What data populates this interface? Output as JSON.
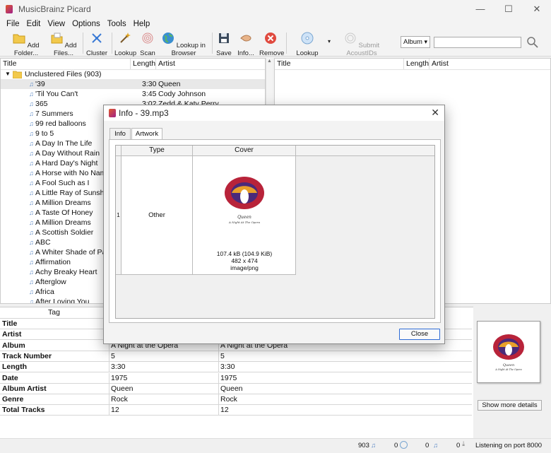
{
  "window": {
    "title": "MusicBrainz Picard",
    "controls": [
      "—",
      "☐",
      "✕"
    ]
  },
  "menu": [
    "File",
    "Edit",
    "View",
    "Options",
    "Tools",
    "Help"
  ],
  "toolbar": {
    "buttons": [
      {
        "label": "Add Folder...",
        "icon": "folder-icon"
      },
      {
        "label": "Add Files...",
        "icon": "files-icon"
      },
      {
        "label": "Cluster",
        "icon": "cluster-icon"
      },
      {
        "label": "Lookup",
        "icon": "magic-wand-icon"
      },
      {
        "label": "Scan",
        "icon": "fingerprint-icon"
      },
      {
        "label": "Lookup in Browser",
        "icon": "globe-icon"
      },
      {
        "label": "Save",
        "icon": "save-icon"
      },
      {
        "label": "Info...",
        "icon": "info-hand-icon"
      },
      {
        "label": "Remove",
        "icon": "remove-icon"
      },
      {
        "label": "Lookup CD...",
        "icon": "cd-icon"
      },
      {
        "label": "Submit AcoustIDs",
        "icon": "acoustid-icon"
      }
    ],
    "search_type": "Album",
    "search_value": ""
  },
  "left_pane": {
    "columns": [
      "Title",
      "Length",
      "Artist"
    ],
    "cluster_label": "Unclustered Files (903)",
    "files": [
      {
        "title": "'39",
        "length": "3:30",
        "artist": "Queen"
      },
      {
        "title": "'Til You Can't",
        "length": "3:45",
        "artist": "Cody Johnson"
      },
      {
        "title": "365",
        "length": "3:02",
        "artist": "Zedd & Katy Perry"
      },
      {
        "title": "7 Summers",
        "length": "",
        "artist": ""
      },
      {
        "title": "99 red balloons",
        "length": "",
        "artist": ""
      },
      {
        "title": "9 to 5",
        "length": "",
        "artist": ""
      },
      {
        "title": "A Day In The Life",
        "length": "",
        "artist": ""
      },
      {
        "title": "A Day Without Rain",
        "length": "",
        "artist": ""
      },
      {
        "title": "A Hard Day's Night",
        "length": "",
        "artist": ""
      },
      {
        "title": "A Horse with No Name",
        "length": "",
        "artist": ""
      },
      {
        "title": "A Fool Such as I",
        "length": "",
        "artist": ""
      },
      {
        "title": "A Little Ray of Sunshine",
        "length": "",
        "artist": ""
      },
      {
        "title": "A Million Dreams",
        "length": "",
        "artist": ""
      },
      {
        "title": "A Taste Of Honey",
        "length": "",
        "artist": ""
      },
      {
        "title": "A Million Dreams",
        "length": "",
        "artist": ""
      },
      {
        "title": "A Scottish Soldier",
        "length": "",
        "artist": ""
      },
      {
        "title": "ABC",
        "length": "",
        "artist": ""
      },
      {
        "title": "A Whiter Shade of Pale",
        "length": "",
        "artist": ""
      },
      {
        "title": "Affirmation",
        "length": "",
        "artist": ""
      },
      {
        "title": "Achy Breaky Heart",
        "length": "",
        "artist": ""
      },
      {
        "title": "Afterglow",
        "length": "",
        "artist": ""
      },
      {
        "title": "Africa",
        "length": "",
        "artist": ""
      },
      {
        "title": "After Loving You",
        "length": "",
        "artist": ""
      }
    ]
  },
  "right_pane": {
    "columns": [
      "Title",
      "Length",
      "Artist"
    ]
  },
  "metadata": {
    "tag_header": "Tag",
    "rows": [
      {
        "tag": "Title",
        "original": "",
        "new": ""
      },
      {
        "tag": "Artist",
        "original": "",
        "new": ""
      },
      {
        "tag": "Album",
        "original": "A Night at the Opera",
        "new": "A Night at the Opera"
      },
      {
        "tag": "Track Number",
        "original": "5",
        "new": "5"
      },
      {
        "tag": "Length",
        "original": "3:30",
        "new": "3:30"
      },
      {
        "tag": "Date",
        "original": "1975",
        "new": "1975"
      },
      {
        "tag": "Album Artist",
        "original": "Queen",
        "new": "Queen"
      },
      {
        "tag": "Genre",
        "original": "Rock",
        "new": "Rock"
      },
      {
        "tag": "Total Tracks",
        "original": "12",
        "new": "12"
      }
    ]
  },
  "show_more_label": "Show more details",
  "status": {
    "files_count": "903",
    "pending_1": "0",
    "pending_2": "0",
    "pending_3": "0",
    "listening": "Listening on port 8000"
  },
  "dialog": {
    "title": "Info - 39.mp3",
    "tabs": [
      "Info",
      "Artwork"
    ],
    "active_tab": "Artwork",
    "table_headers": [
      "Type",
      "Cover"
    ],
    "row_number": "1",
    "type_value": "Other",
    "cover_size": "107.4 kB (104.9 KiB)",
    "cover_dimensions": "482 x 474",
    "cover_mime": "image/png",
    "cover_title": "Queen",
    "cover_subtitle": "A Night At The Opera",
    "close_label": "Close"
  },
  "colors": {
    "accent": "#2d6bd6",
    "folder": "#f2c94c",
    "remove": "#e04a3f"
  }
}
